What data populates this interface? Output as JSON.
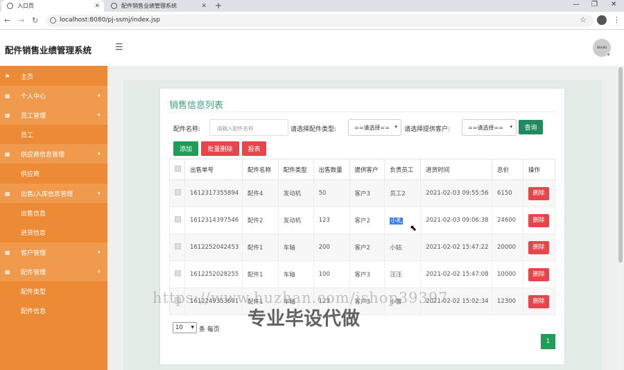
{
  "browser": {
    "tabs": [
      {
        "title": "入口页",
        "active": true
      },
      {
        "title": "配件销售业绩管理系统",
        "active": false
      }
    ],
    "url": "localhost:8080/pj-ssmj/index.jsp"
  },
  "header": {
    "app_title": "配件销售业绩管理系统",
    "avatar_text": "80x80"
  },
  "sidebar": {
    "items": [
      {
        "label": "主页",
        "type": "top"
      },
      {
        "label": "个人中心",
        "type": "group"
      },
      {
        "label": "员工管理",
        "type": "group"
      },
      {
        "label": "员工",
        "type": "sub"
      },
      {
        "label": "供应商信息管理",
        "type": "group"
      },
      {
        "label": "供应商",
        "type": "sub"
      },
      {
        "label": "出售/入库信息管理",
        "type": "group"
      },
      {
        "label": "出售信息",
        "type": "sub"
      },
      {
        "label": "进货信息",
        "type": "sub"
      },
      {
        "label": "客户管理",
        "type": "group"
      },
      {
        "label": "配件管理",
        "type": "group"
      },
      {
        "label": "配件类型",
        "type": "sub"
      },
      {
        "label": "配件信息",
        "type": "sub"
      }
    ]
  },
  "main": {
    "card_title": "销售信息列表",
    "filters": {
      "name_label": "配件名称:",
      "name_placeholder": "请输入配件名称",
      "type_label": "请选择配件类型:",
      "type_value": "==请选择==",
      "customer_label": "请选择提供客户:",
      "customer_value": "==请选择==",
      "search_button": "查询"
    },
    "actions": {
      "add": "添加",
      "batch_delete": "批量删除",
      "report": "报表"
    },
    "table": {
      "headers": [
        "出售单号",
        "配件名称",
        "配件类型",
        "出售数量",
        "提供客户",
        "负责员工",
        "进货时间",
        "总价",
        "操作"
      ],
      "rows": [
        {
          "id": "1612317355894",
          "part": "配件4",
          "type": "发动机",
          "qty": "50",
          "customer": "客户3",
          "staff": "员工2",
          "time": "2021-02-03 09:55:56",
          "total": "6150",
          "action": "删除"
        },
        {
          "id": "1612314397546",
          "part": "配件2",
          "type": "发动机",
          "qty": "123",
          "customer": "客户2",
          "staff": "小札",
          "time": "2021-02-03 09:06:38",
          "total": "24600",
          "action": "删除"
        },
        {
          "id": "1612252042453",
          "part": "配件1",
          "type": "车轴",
          "qty": "200",
          "customer": "客户2",
          "staff": "小姑",
          "time": "2021-02-02 15:47:22",
          "total": "20000",
          "action": "删除"
        },
        {
          "id": "1612252028255",
          "part": "配件1",
          "type": "车轴",
          "qty": "100",
          "customer": "客户3",
          "staff": "汪汪",
          "time": "2021-02-02 15:47:08",
          "total": "10000",
          "action": "删除"
        },
        {
          "id": "1612249353601",
          "part": "配件1",
          "type": "车轴",
          "qty": "123",
          "customer": "客户3",
          "staff": "小雷",
          "time": "2021-02-02 15:02:34",
          "total": "12300",
          "action": "删除"
        }
      ]
    },
    "pagination": {
      "page_size": "10",
      "per_page_label": "条 每页",
      "current_page": "1"
    }
  },
  "watermarks": {
    "url": "https://www.huzhan.com/ishop39397",
    "text": "专业毕设代做"
  }
}
